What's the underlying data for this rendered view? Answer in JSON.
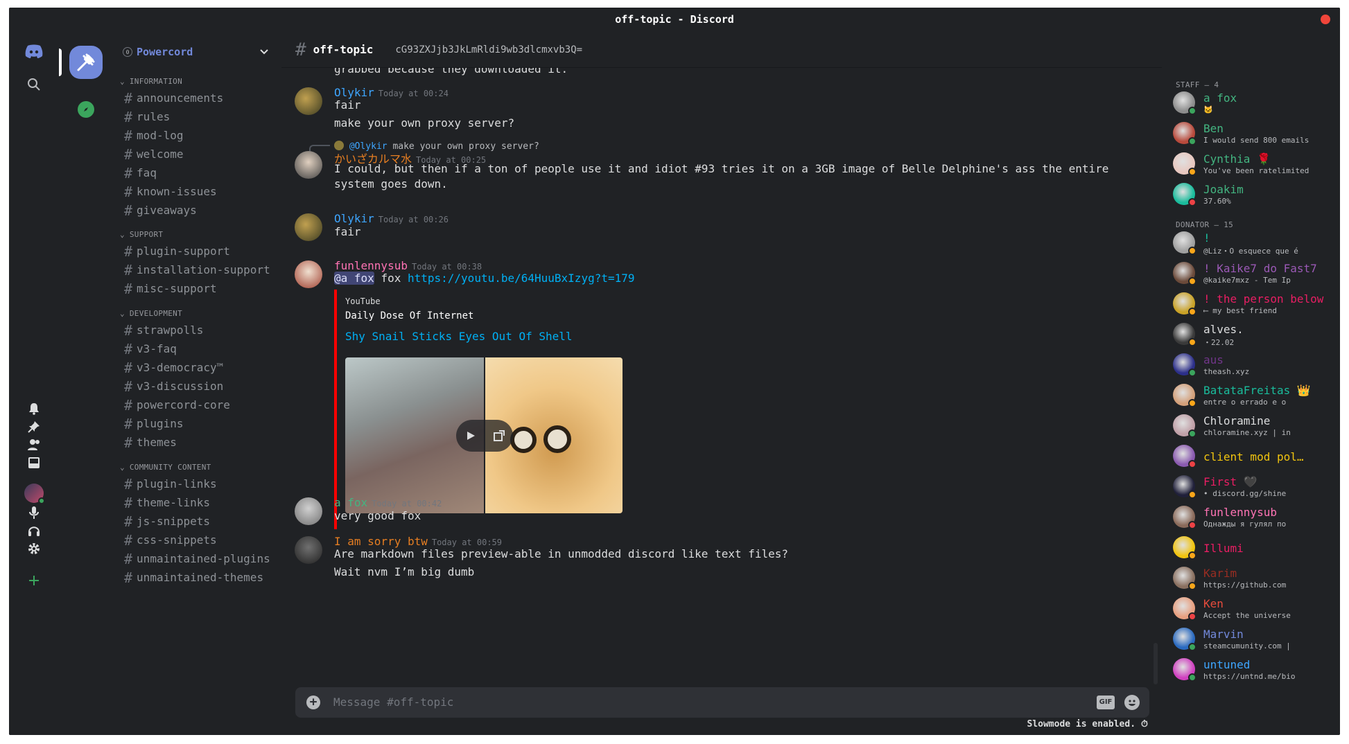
{
  "window": {
    "title": "off-topic - Discord"
  },
  "guild": {
    "badge": "0",
    "name": "Powercord"
  },
  "categories": [
    {
      "label": "INFORMATION",
      "channels": [
        "announcements",
        "rules",
        "mod-log",
        "welcome",
        "faq",
        "known-issues",
        "giveaways"
      ]
    },
    {
      "label": "SUPPORT",
      "channels": [
        "plugin-support",
        "installation-support",
        "misc-support"
      ]
    },
    {
      "label": "DEVELOPMENT",
      "channels": [
        "strawpolls",
        "v3-faq",
        "v3-democracy™",
        "v3-discussion",
        "powercord-core",
        "plugins",
        "themes"
      ]
    },
    {
      "label": "COMMUNITY CONTENT",
      "channels": [
        "plugin-links",
        "theme-links",
        "js-snippets",
        "css-snippets",
        "unmaintained-plugins",
        "unmaintained-themes"
      ]
    }
  ],
  "channel": {
    "name": "off-topic",
    "topic": "cG93ZXJjb3JkLmRldi9wb3dlcmxvb3Q="
  },
  "messages": {
    "partial_top": "grabbed because they downloaded it.",
    "m1": {
      "author": "Olykir",
      "author_color": "#3ea6ff",
      "time": "Today at 00:24",
      "lines": [
        "fair",
        "make your own proxy server?"
      ]
    },
    "m2": {
      "reply_mention": "@Olykir",
      "reply_text": "make your own proxy server?",
      "author": "かいざカルマ水",
      "author_color": "#e67e22",
      "time": "Today at 00:25",
      "lines": [
        "I could, but then if a ton of people use it and idiot #93 tries it on a 3GB image of Belle Delphine's ass the entire",
        "system goes down."
      ]
    },
    "m3": {
      "author": "Olykir",
      "author_color": "#3ea6ff",
      "time": "Today at 00:26",
      "lines": [
        "fair"
      ]
    },
    "m4": {
      "author": "funlennysub",
      "author_color": "#ff73b4",
      "time": "Today at 00:38",
      "mention": "@a fox",
      "text": "fox",
      "link": "https://youtu.be/64HuuBxIzyg?t=179"
    },
    "embed": {
      "provider": "YouTube",
      "author": "Daily Dose Of Internet",
      "title": "Shy Snail Sticks Eyes Out Of Shell"
    },
    "m5": {
      "author": "a fox",
      "author_color": "#43b581",
      "time": "Today at 00:42",
      "lines": [
        "very good fox"
      ]
    },
    "m6": {
      "author": "I am sorry btw",
      "author_color": "#e67e22",
      "time": "Today at 00:59",
      "lines": [
        "Are markdown files preview-able in unmodded discord like text files?",
        "Wait nvm I’m big dumb"
      ]
    }
  },
  "composer": {
    "placeholder": "Message #off-topic",
    "gif_label": "GIF"
  },
  "slowmode": "Slowmode is enabled.",
  "member_groups": [
    {
      "label": "STAFF — 4",
      "members": [
        {
          "name": "a fox",
          "color": "#43b581",
          "sub": "🐱",
          "status": "#3ba55d",
          "av": "#8d8d8d"
        },
        {
          "name": "Ben",
          "color": "#43b581",
          "sub": "I would send 800 emails",
          "status": "#3ba55d",
          "av": "#b84a3c"
        },
        {
          "name": "Cynthia 🌹",
          "color": "#43b581",
          "sub": "You've been ratelimited",
          "status": "#faa61a",
          "av": "#e8c8c0"
        },
        {
          "name": "Joakim",
          "color": "#43b581",
          "sub": "37.60%",
          "status": "#ed4245",
          "av": "#1abc9c"
        }
      ]
    },
    {
      "label": "DONATOR — 15",
      "members": [
        {
          "name": "!",
          "color": "#1abc9c",
          "sub": "@Liz・O esquece que é",
          "status": "#faa61a",
          "av": "#a0a0a0"
        },
        {
          "name": "! Kaike7 do Fast7",
          "color": "#9b59b6",
          "sub": "@kaike7mxz - Tem Ip",
          "status": "#faa61a",
          "av": "#6b4a3a"
        },
        {
          "name": "! the person below",
          "color": "#e91e63",
          "sub": "⟵ my best friend",
          "status": "#faa61a",
          "av": "#c9a227"
        },
        {
          "name": "alves.",
          "color": "#dcddde",
          "sub": "・22.02",
          "status": "#faa61a",
          "av": "#3a3a3a"
        },
        {
          "name": "aus",
          "color": "#71368a",
          "sub": "theash.xyz",
          "status": "#3ba55d",
          "av": "#2c2f8a"
        },
        {
          "name": "BatataFreitas 👑",
          "color": "#1abc9c",
          "sub": "entre o errado e o",
          "status": "#faa61a",
          "av": "#d4a07a"
        },
        {
          "name": "Chloramine",
          "color": "#dcddde",
          "sub": "chloramine.xyz | in",
          "status": "#3ba55d",
          "av": "#c0a0a8"
        },
        {
          "name": "client mod pol…",
          "color": "#f1c40f",
          "sub": "",
          "status": "#ed4245",
          "av": "#8a5ab0"
        },
        {
          "name": "First 🖤",
          "color": "#e91e63",
          "sub": "• discord.gg/shine",
          "status": "#faa61a",
          "av": "#20203a"
        },
        {
          "name": "funlennysub",
          "color": "#ff73b4",
          "sub": "Однажды я гулял по",
          "status": "#ed4245",
          "av": "#8a6a5a"
        },
        {
          "name": "Illumi",
          "color": "#e91e63",
          "sub": "",
          "status": "#faa61a",
          "av": "#f1c40f"
        },
        {
          "name": "Karim",
          "color": "#992d22",
          "sub": "https://github.com",
          "status": "#faa61a",
          "av": "#8a7060"
        },
        {
          "name": "Ken",
          "color": "#e74c3c",
          "sub": "Accept the universe",
          "status": "#ed4245",
          "av": "#e8a080"
        },
        {
          "name": "Marvin",
          "color": "#7289da",
          "sub": "steamcumunity.com |",
          "status": "#3ba55d",
          "av": "#2a6ac0"
        },
        {
          "name": "untuned",
          "color": "#3ea6ff",
          "sub": "https://untnd.me/bio",
          "status": "#3ba55d",
          "av": "#d040c0"
        }
      ]
    }
  ]
}
